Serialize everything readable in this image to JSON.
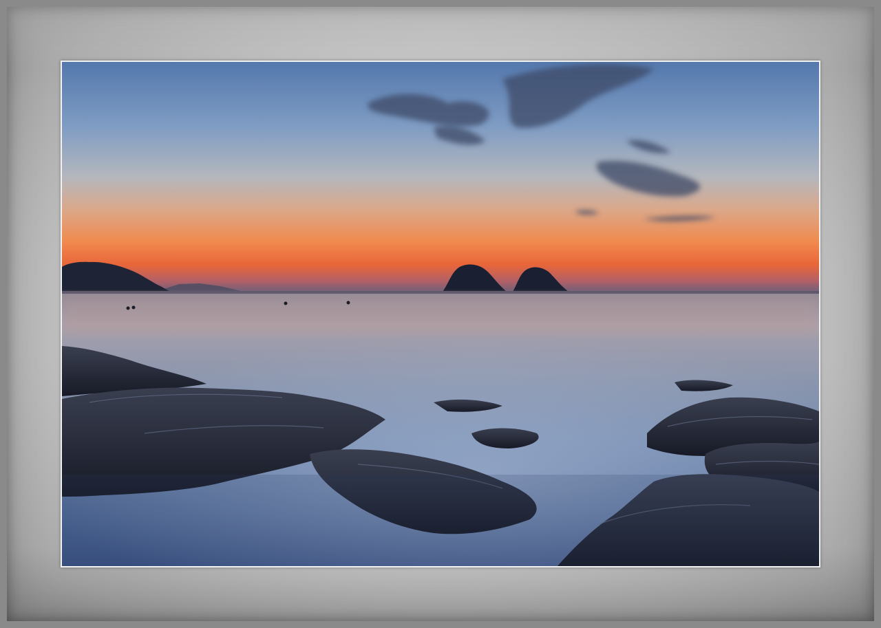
{
  "scene": {
    "subject": "seascape-at-dusk",
    "colors": {
      "sky_top": "#5a7fb0",
      "sky_mid": "#a9aeb4",
      "horizon_glow": "#f07a3a",
      "sea": "#7f8ea8",
      "rocks": "#1e2230",
      "mat": "#c4c4c4"
    }
  }
}
